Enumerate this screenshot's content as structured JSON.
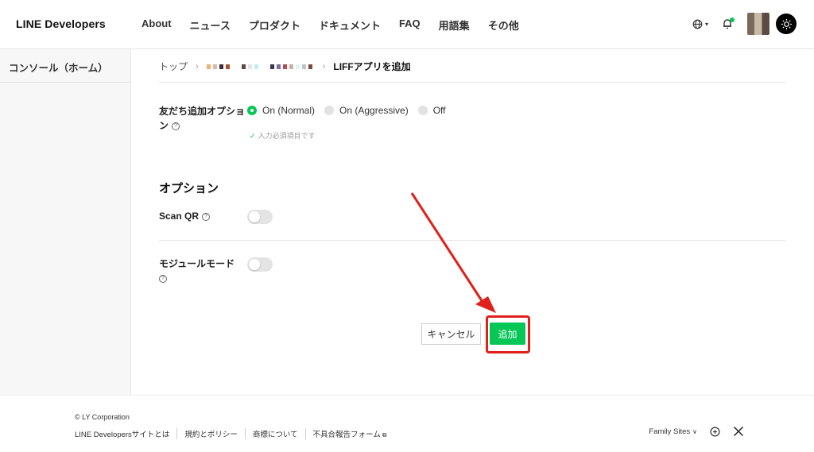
{
  "header": {
    "logo": "LINE Developers",
    "nav": [
      "About",
      "ニュース",
      "プロダクト",
      "ドキュメント",
      "FAQ",
      "用語集",
      "その他"
    ]
  },
  "sidebar": {
    "items": [
      {
        "label": "コンソール（ホーム）"
      }
    ]
  },
  "breadcrumb": {
    "root": "トップ",
    "current": "LIFFアプリを追加"
  },
  "friend_option": {
    "label_line1": "友だち追加オプショ",
    "label_line2": "ン",
    "options": [
      "On (Normal)",
      "On (Aggressive)",
      "Off"
    ],
    "selected": "On (Normal)",
    "required_note": "入力必須項目です"
  },
  "options_section": {
    "title": "オプション",
    "scan_qr": {
      "label": "Scan QR",
      "enabled": false
    },
    "module_mode": {
      "label": "モジュールモード",
      "enabled": false
    }
  },
  "actions": {
    "cancel": "キャンセル",
    "add": "追加"
  },
  "footer": {
    "copyright": "© LY Corporation",
    "links": [
      "LINE Developersサイトとは",
      "規約とポリシー",
      "商標について",
      "不具合報告フォーム"
    ],
    "family_sites": "Family Sites"
  },
  "colors": {
    "accent": "#06c755",
    "annotation": "#e0201a"
  }
}
